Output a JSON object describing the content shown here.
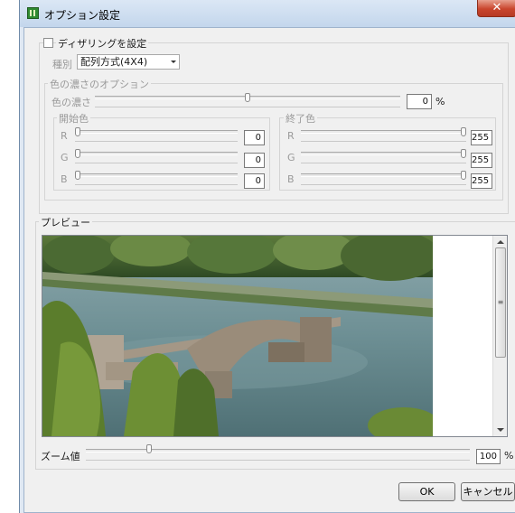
{
  "window": {
    "title": "オプション設定",
    "close_label": "✕"
  },
  "dither": {
    "checkbox_label": "ディザリングを設定",
    "type_label": "種別",
    "type_value": "配列方式(4X4)"
  },
  "density": {
    "group_label": "色の濃さのオプション",
    "label": "色の濃さ",
    "value": "0",
    "unit": "%",
    "slider_fraction": 0.5
  },
  "start_color": {
    "group_label": "開始色",
    "channels": [
      {
        "label": "R",
        "value": "0",
        "fraction": 0
      },
      {
        "label": "G",
        "value": "0",
        "fraction": 0
      },
      {
        "label": "B",
        "value": "0",
        "fraction": 0
      }
    ]
  },
  "end_color": {
    "group_label": "終了色",
    "channels": [
      {
        "label": "R",
        "value": "255",
        "fraction": 1
      },
      {
        "label": "G",
        "value": "255",
        "fraction": 1
      },
      {
        "label": "B",
        "value": "255",
        "fraction": 1
      }
    ]
  },
  "preview": {
    "group_label": "プレビュー"
  },
  "zoom": {
    "label": "ズーム値",
    "value": "100",
    "unit": "%",
    "slider_fraction": 0.16
  },
  "buttons": {
    "ok": "OK",
    "cancel": "キャンセル"
  },
  "colors": {
    "titlebar": "#c3d6ec",
    "close": "#c9452d",
    "app_icon": "#2f8a31"
  }
}
